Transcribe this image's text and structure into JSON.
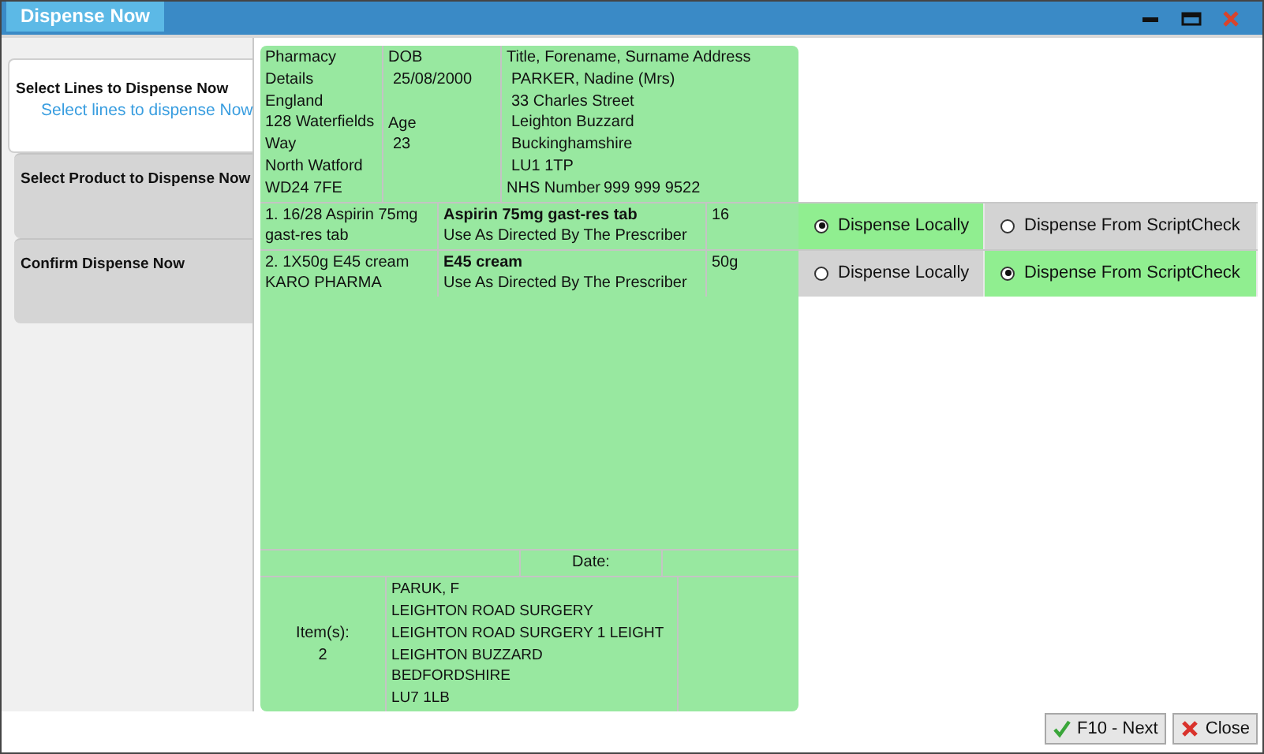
{
  "window": {
    "title": "Dispense Now"
  },
  "steps": [
    {
      "title": "Select Lines to Dispense Now",
      "selected": true,
      "sub": "Select lines to dispense Now"
    },
    {
      "title": "Select Product to Dispense Now",
      "selected": false
    },
    {
      "title": "Confirm Dispense Now",
      "selected": false
    }
  ],
  "header": {
    "pharmacy": [
      "Pharmacy",
      "Details",
      "England",
      "128 Waterfields",
      "Way",
      "North Watford",
      "WD24 7FE"
    ],
    "dob_label": "DOB",
    "dob": "25/08/2000",
    "age_label": "Age",
    "age": "23",
    "address_label": "Title, Forename, Surname Address",
    "patient": [
      "PARKER, Nadine (Mrs)",
      "33 Charles Street",
      "Leighton Buzzard",
      "Buckinghamshire",
      "LU1 1TP"
    ],
    "nhs_label": "NHS Number",
    "nhs_number": "999 999 9522"
  },
  "lines": [
    {
      "description": "1. 16/28 Aspirin 75mg gast-res tab",
      "product": "Aspirin 75mg gast-res tab",
      "directions": "Use As Directed By The Prescriber",
      "quantity": "16",
      "options": [
        {
          "label": "Dispense Locally",
          "selected": true
        },
        {
          "label": "Dispense From ScriptCheck",
          "selected": false
        }
      ]
    },
    {
      "description": "2. 1X50g E45 cream KARO PHARMA",
      "product": "E45 cream",
      "directions": "Use As Directed By The Prescriber",
      "quantity": "50g",
      "options": [
        {
          "label": "Dispense Locally",
          "selected": false
        },
        {
          "label": "Dispense From ScriptCheck",
          "selected": true
        }
      ]
    }
  ],
  "date_label": "Date:",
  "items_label": "Item(s):",
  "items_count": "2",
  "prescriber": [
    "PARUK, F",
    "LEIGHTON ROAD SURGERY",
    "LEIGHTON ROAD SURGERY 1 LEIGHT",
    "LEIGHTON BUZZARD",
    "BEDFORDSHIRE",
    "LU7 1LB"
  ],
  "buttons": [
    {
      "kind": "next",
      "label": "F10 - Next"
    },
    {
      "kind": "close",
      "label": "Close"
    }
  ]
}
